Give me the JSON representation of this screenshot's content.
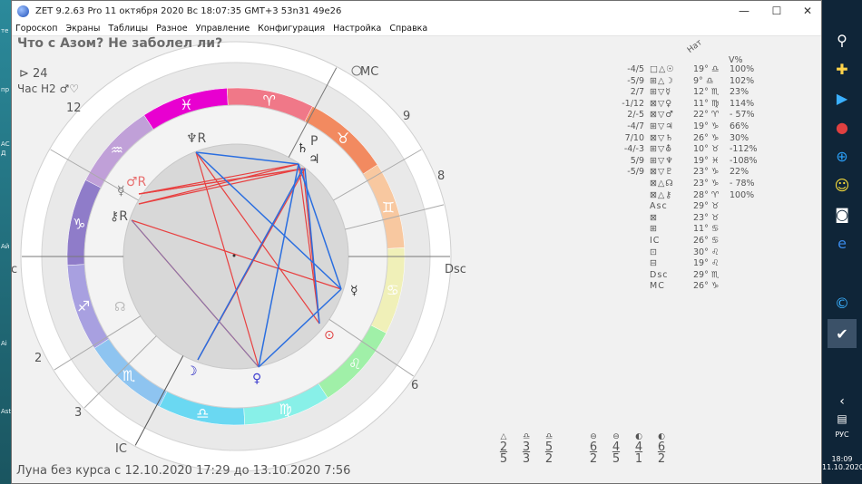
{
  "desktop_labels": [
    "те",
    "пр",
    "АС",
    "Д",
    "Ай",
    "Ai",
    "Ast"
  ],
  "window": {
    "title": "ZET 9.2.63 Pro   11 октября 2020  Вс   18:07:35 GMT+3 53n31  49e26",
    "minimize_icon": "—",
    "maximize_icon": "☐",
    "close_icon": "✕"
  },
  "menu": [
    "Гороскоп",
    "Экраны",
    "Таблицы",
    "Разное",
    "Управление",
    "Конфигурация",
    "Настройка",
    "Справка"
  ],
  "chart": {
    "question": "Что с Азом? Не заболел ли?",
    "days_label": "24",
    "hour_label": "Час H2 ♂♡",
    "angles": {
      "asc": "c",
      "mc": "MC",
      "dsc": "Dsc",
      "ic": "IC"
    },
    "house_numbers": [
      "12",
      "9",
      "8",
      "6",
      "3",
      "2"
    ],
    "zodiac": [
      {
        "glyph": "♓",
        "color": "#e800d0"
      },
      {
        "glyph": "♒",
        "color": "#c0a0d8"
      },
      {
        "glyph": "♑",
        "color": "#8f7cc9"
      },
      {
        "glyph": "♐",
        "color": "#a8a0e0"
      },
      {
        "glyph": "♏",
        "color": "#8ec4f0"
      },
      {
        "glyph": "♎",
        "color": "#6ad8f2"
      },
      {
        "glyph": "♍",
        "color": "#88f0e8"
      },
      {
        "glyph": "♌",
        "color": "#a0f0a8"
      },
      {
        "glyph": "♋",
        "color": "#f0f0b8"
      },
      {
        "glyph": "♊",
        "color": "#f8c8a0"
      },
      {
        "glyph": "♉",
        "color": "#f28a60"
      },
      {
        "glyph": "♈",
        "color": "#f07888"
      }
    ],
    "planets": [
      {
        "glyph": "♆R",
        "color": "#555"
      },
      {
        "glyph": "♄",
        "color": "#333"
      },
      {
        "glyph": "P",
        "color": "#555"
      },
      {
        "glyph": "♃",
        "color": "#333"
      },
      {
        "glyph": "♂R",
        "color": "#e87070"
      },
      {
        "glyph": "☿",
        "color": "#777"
      },
      {
        "glyph": "⚷R",
        "color": "#555"
      },
      {
        "glyph": "☊",
        "color": "#bbb"
      },
      {
        "glyph": "☽",
        "color": "#2020c0"
      },
      {
        "glyph": "♀",
        "color": "#4040d0"
      },
      {
        "glyph": "☿",
        "color": "#333"
      },
      {
        "glyph": "⊙",
        "color": "#e04040"
      }
    ],
    "moon_void": "Луна без курса с 12.10.2020  17:29 до 13.10.2020  7:56"
  },
  "aspect_table": {
    "header_nat": "Нат",
    "header_v": "V%",
    "rows": [
      {
        "a": "-4/5",
        "sym": "□△☉",
        "deg": "19° ♎",
        "pct": "100%"
      },
      {
        "a": "-5/9",
        "sym": "⊞△☽",
        "deg": "9° ♎",
        "pct": "102%"
      },
      {
        "a": "2/7",
        "sym": "⊞▽☿",
        "deg": "12° ♏",
        "pct": "23%"
      },
      {
        "a": "-1/12",
        "sym": "⊠▽♀",
        "deg": "11° ♍",
        "pct": "114%"
      },
      {
        "a": "2/-5",
        "sym": "⊠▽♂",
        "deg": "22° ♈",
        "pct": "- 57%"
      },
      {
        "a": "-4/7",
        "sym": "⊞▽♃",
        "deg": "19° ♑",
        "pct": "66%"
      },
      {
        "a": "7/10",
        "sym": "⊠▽♄",
        "deg": "26° ♑",
        "pct": "30%"
      },
      {
        "a": "-4/-3",
        "sym": "⊞▽⛢",
        "deg": "10° ♉",
        "pct": "-112%"
      },
      {
        "a": "5/9",
        "sym": "⊞▽♆",
        "deg": "19° ♓",
        "pct": "-108%"
      },
      {
        "a": "-5/9",
        "sym": "⊠▽♇",
        "deg": "23° ♑",
        "pct": "22%"
      },
      {
        "a": "",
        "sym": "⊠△☊",
        "deg": "23° ♑",
        "pct": "- 78%"
      },
      {
        "a": "",
        "sym": "⊠△⚷",
        "deg": "28° ♈",
        "pct": "100%"
      },
      {
        "a": "",
        "sym": "Asc",
        "deg": "29° ♉",
        "pct": ""
      },
      {
        "a": "",
        "sym": "⊠",
        "deg": "23° ♉",
        "pct": ""
      },
      {
        "a": "",
        "sym": "⊞",
        "deg": "11° ♋",
        "pct": ""
      },
      {
        "a": "",
        "sym": "IC",
        "deg": "26° ♋",
        "pct": ""
      },
      {
        "a": "",
        "sym": "⊡",
        "deg": "30° ♌",
        "pct": ""
      },
      {
        "a": "",
        "sym": "⊟",
        "deg": "19° ♌",
        "pct": ""
      },
      {
        "a": "",
        "sym": "Dsc",
        "deg": "29° ♏",
        "pct": ""
      },
      {
        "a": "",
        "sym": "MC",
        "deg": "26° ♑",
        "pct": ""
      }
    ]
  },
  "counts": [
    {
      "sym": "△",
      "top": "2",
      "bot": "5"
    },
    {
      "sym": "♎",
      "top": "3",
      "bot": "3"
    },
    {
      "sym": "♎",
      "top": "5",
      "bot": "2"
    },
    {
      "sym": "⊖",
      "top": "6",
      "bot": "2"
    },
    {
      "sym": "⊖",
      "top": "4",
      "bot": "5"
    },
    {
      "sym": "◐",
      "top": "4",
      "bot": "1"
    },
    {
      "sym": "◐",
      "top": "6",
      "bot": "2"
    }
  ],
  "taskbar": {
    "icons": [
      "search-icon",
      "plus-icon",
      "play-icon",
      "record-icon",
      "zoom-icon",
      "smiley-icon",
      "camera-icon",
      "edge-icon",
      "c-icon",
      "zet-icon"
    ],
    "tray_arrow": "‹",
    "lang": "РУС",
    "time": "18:09",
    "date": "11.10.2020"
  }
}
